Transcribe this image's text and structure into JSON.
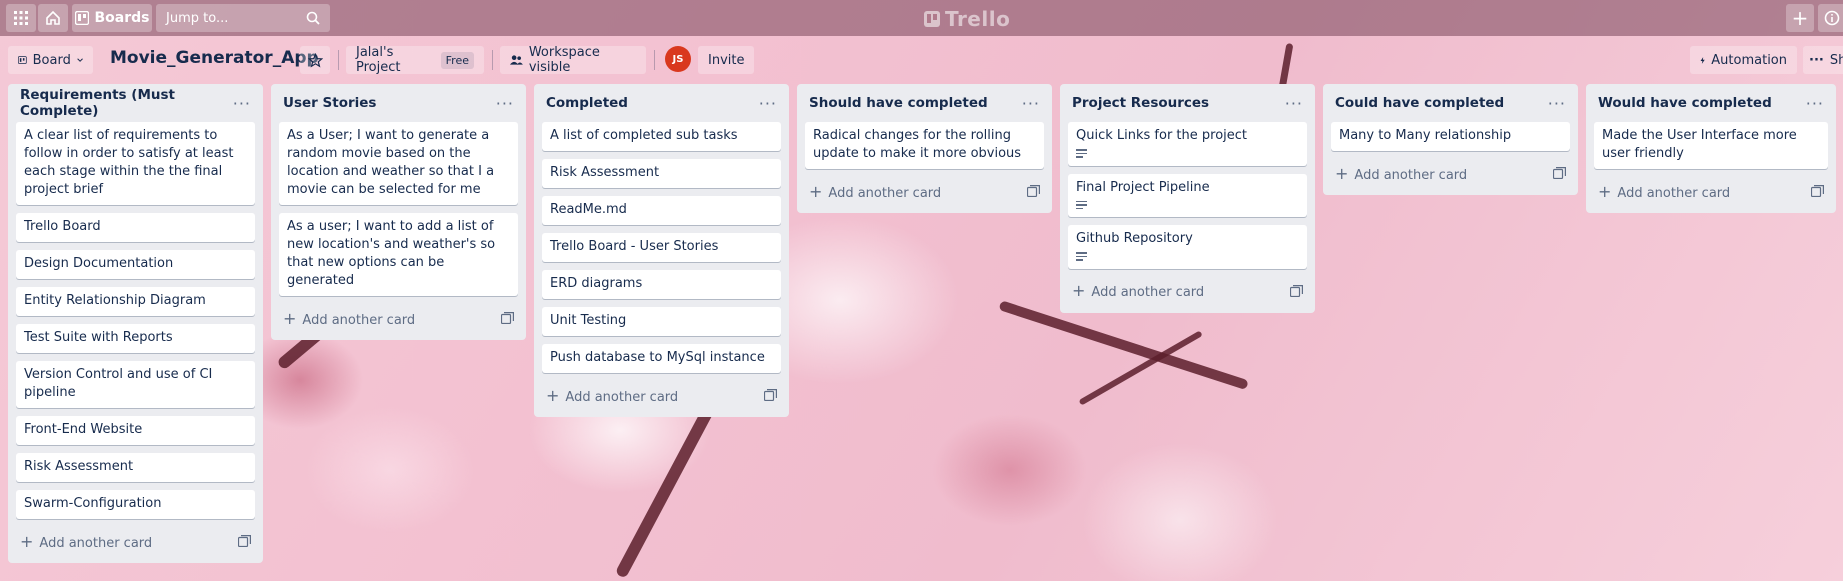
{
  "header": {
    "boards_label": "Boards",
    "search_placeholder": "Jump to...",
    "brand": "Trello"
  },
  "board": {
    "view_label": "Board",
    "title": "Movie_Generator_App",
    "workspace": "Jalal's Project",
    "plan_badge": "Free",
    "visibility": "Workspace visible",
    "avatar_initials": "JS",
    "invite_label": "Invite",
    "automation_label": "Automation",
    "show_menu_label": "Sh"
  },
  "lists": [
    {
      "title": "Requirements (Must Complete)",
      "cards": [
        "A clear list of requirements to follow in order to satisfy at least each stage within the the final project brief",
        "Trello Board",
        "Design Documentation",
        "Entity Relationship Diagram",
        "Test Suite with Reports",
        "Version Control and use of CI pipeline",
        "Front-End Website",
        "Risk Assessment",
        "Swarm-Configuration"
      ],
      "add_label": "Add another card"
    },
    {
      "title": "User Stories",
      "cards": [
        "As a User; I want to generate a random movie based on the location and weather so that I a movie can be selected for me",
        "As a user; I want to add a list of new location's and weather's so that new options can be generated"
      ],
      "add_label": "Add another card"
    },
    {
      "title": "Completed",
      "cards": [
        "A list of completed sub tasks",
        "Risk Assessment",
        "ReadMe.md",
        "Trello Board - User Stories",
        "ERD diagrams",
        "Unit Testing",
        "Push database to MySql instance"
      ],
      "add_label": "Add another card"
    },
    {
      "title": "Should have completed",
      "cards": [
        "Radical changes for the rolling update to make it more obvious"
      ],
      "add_label": "Add another card"
    },
    {
      "title": "Project Resources",
      "cards": [
        "Quick Links for the project",
        "Final Project Pipeline",
        "Github Repository"
      ],
      "add_label": "Add another card"
    },
    {
      "title": "Could have completed",
      "cards": [
        "Many to Many relationship"
      ],
      "add_label": "Add another card"
    },
    {
      "title": "Would have completed",
      "cards": [
        "Made the User Interface more user friendly"
      ],
      "add_label": "Add another card"
    }
  ]
}
